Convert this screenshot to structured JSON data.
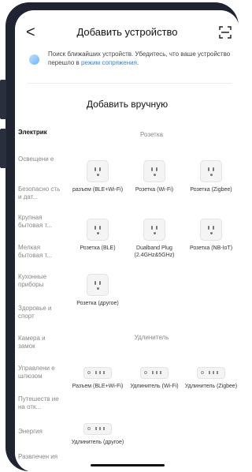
{
  "header": {
    "back_glyph": "<",
    "title": "Добавить устройство",
    "scan_icon": "scan-icon"
  },
  "notice": {
    "text": "Поиск ближайших устройств. Убедитесь, что ваше устройство перешло в ",
    "link": "режим сопряжения",
    "suffix": "."
  },
  "section_heading": "Добавить вручную",
  "sidebar": [
    {
      "label": "Электрик",
      "active": true
    },
    {
      "label": "Освещени е"
    },
    {
      "label": "Безопасно сть и дат..."
    },
    {
      "label": "Крупная бытовая т..."
    },
    {
      "label": "Мелкая бытовая т..."
    },
    {
      "label": "Кухонные приборы"
    },
    {
      "label": "Здоровье и спорт"
    },
    {
      "label": "Камера и замок"
    },
    {
      "label": "Управлени е шлюзом"
    },
    {
      "label": "Путешеств ие на отк..."
    },
    {
      "label": "Энергия"
    },
    {
      "label": "Развлечен ия"
    }
  ],
  "sections": [
    {
      "title": "Розетка",
      "devices": [
        {
          "label": "разъем (BLE+Wi-Fi)",
          "icon": "socket-icon"
        },
        {
          "label": "Розетка (Wi-Fi)",
          "icon": "socket-icon"
        },
        {
          "label": "Розетка (Zigbee)",
          "icon": "socket-icon"
        },
        {
          "label": "Розетка (BLE)",
          "icon": "socket-icon"
        },
        {
          "label": "Dualband Plug (2.4GHz&5GHz)",
          "icon": "socket-icon"
        },
        {
          "label": "Розетка (NB-IoT)",
          "icon": "socket-icon"
        },
        {
          "label": "Розетка (другое)",
          "icon": "socket-icon"
        }
      ]
    },
    {
      "title": "Удлинитель",
      "devices": [
        {
          "label": "Разъем (BLE+Wi-Fi)",
          "icon": "power-strip-icon"
        },
        {
          "label": "Удлинитель (Wi-Fi)",
          "icon": "power-strip-icon"
        },
        {
          "label": "Удлинитель (Zigbee)",
          "icon": "power-strip-icon"
        },
        {
          "label": "Удлинитель (другое)",
          "icon": "power-strip-icon"
        }
      ]
    }
  ]
}
